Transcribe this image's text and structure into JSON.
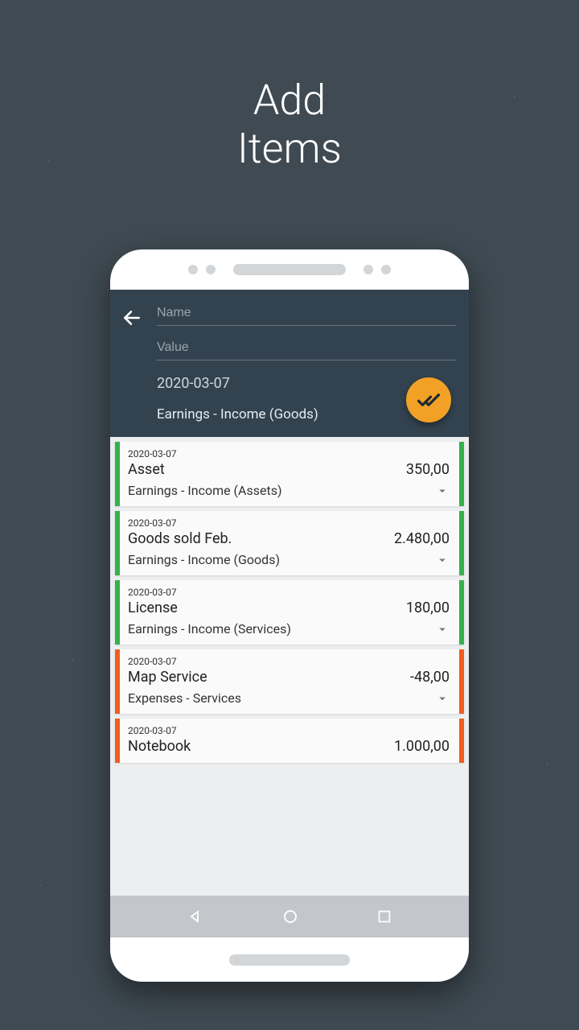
{
  "promo": {
    "line1": "Add",
    "line2": "Items"
  },
  "form": {
    "name_placeholder": "Name",
    "value_placeholder": "Value",
    "date": "2020-03-07",
    "category": "Earnings - Income (Goods)"
  },
  "items": [
    {
      "date": "2020-03-07",
      "name": "Asset",
      "value": "350,00",
      "category": "Earnings - Income (Assets)",
      "color": "green"
    },
    {
      "date": "2020-03-07",
      "name": "Goods sold Feb.",
      "value": "2.480,00",
      "category": "Earnings - Income (Goods)",
      "color": "green"
    },
    {
      "date": "2020-03-07",
      "name": "License",
      "value": "180,00",
      "category": "Earnings - Income (Services)",
      "color": "green"
    },
    {
      "date": "2020-03-07",
      "name": "Map Service",
      "value": "-48,00",
      "category": "Expenses - Services",
      "color": "orange"
    },
    {
      "date": "2020-03-07",
      "name": "Notebook",
      "value": "1.000,00",
      "category": "",
      "color": "orange"
    }
  ]
}
